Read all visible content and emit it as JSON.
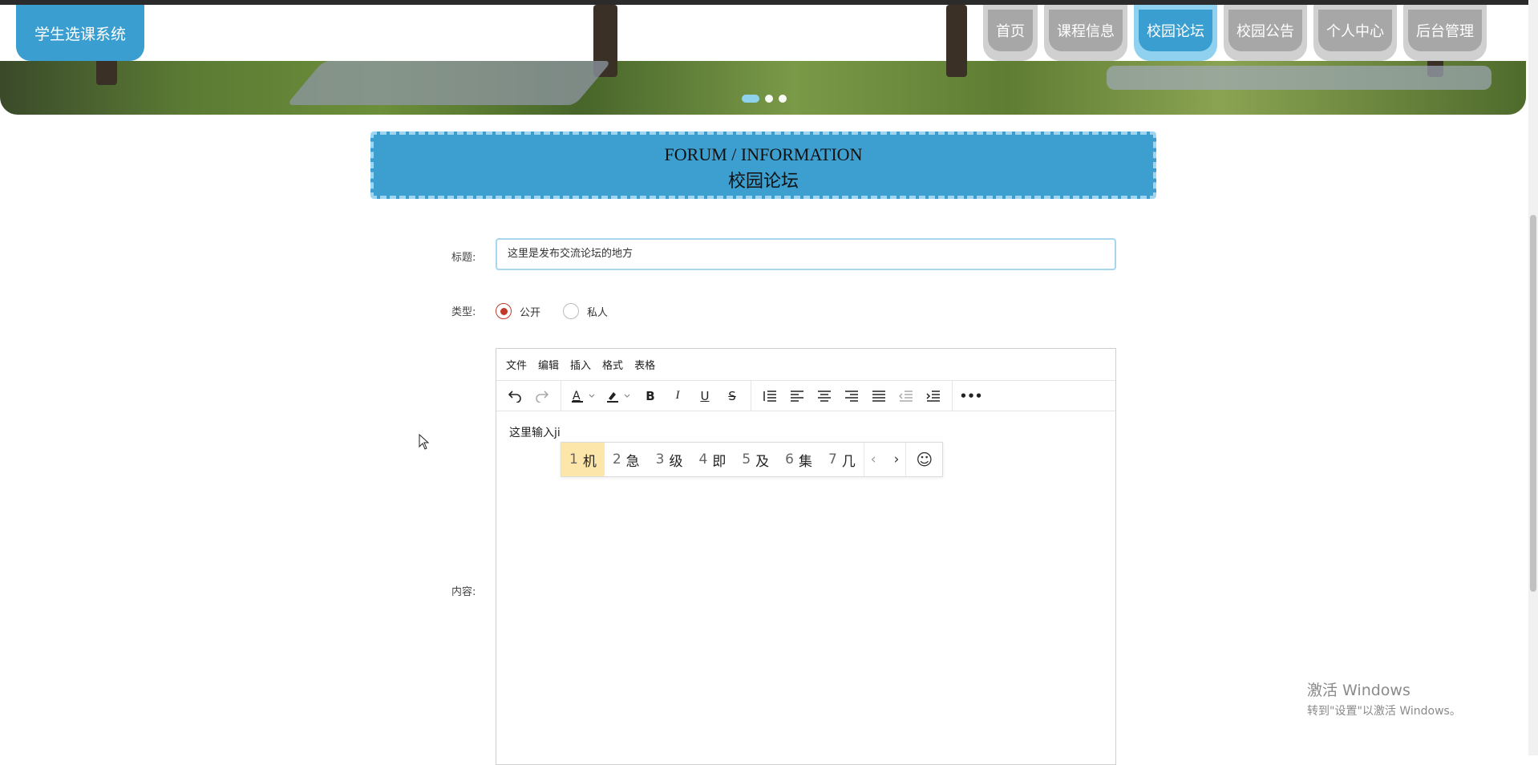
{
  "app": {
    "logo": "学生选课系统"
  },
  "nav": {
    "items": [
      {
        "label": "首页",
        "active": false
      },
      {
        "label": "课程信息",
        "active": false
      },
      {
        "label": "校园论坛",
        "active": true
      },
      {
        "label": "校园公告",
        "active": false
      },
      {
        "label": "个人中心",
        "active": false
      },
      {
        "label": "后台管理",
        "active": false
      }
    ]
  },
  "carousel": {
    "slides": 3,
    "active_index": 0
  },
  "section": {
    "title_en": "FORUM / INFORMATION",
    "title_zh": "校园论坛"
  },
  "form": {
    "title_label": "标题:",
    "title_value": "这里是发布交流论坛的地方",
    "type_label": "类型:",
    "type_options": [
      {
        "label": "公开",
        "checked": true
      },
      {
        "label": "私人",
        "checked": false
      }
    ],
    "content_label": "内容:"
  },
  "editor": {
    "menus": [
      "文件",
      "编辑",
      "插入",
      "格式",
      "表格"
    ],
    "content": "这里输入ji",
    "toolbar_icons": [
      "undo-icon",
      "redo-icon",
      "text-color-icon",
      "highlight-icon",
      "bold-icon",
      "italic-icon",
      "underline-icon",
      "strikethrough-icon",
      "line-height-icon",
      "align-left-icon",
      "align-center-icon",
      "align-right-icon",
      "align-justify-icon",
      "outdent-icon",
      "indent-icon",
      "more-icon"
    ]
  },
  "ime": {
    "candidates": [
      {
        "num": "1",
        "text": "机",
        "selected": true
      },
      {
        "num": "2",
        "text": "急",
        "selected": false
      },
      {
        "num": "3",
        "text": "级",
        "selected": false
      },
      {
        "num": "4",
        "text": "即",
        "selected": false
      },
      {
        "num": "5",
        "text": "及",
        "selected": false
      },
      {
        "num": "6",
        "text": "集",
        "selected": false
      },
      {
        "num": "7",
        "text": "几",
        "selected": false
      }
    ],
    "prev": "‹",
    "next": "›",
    "emoji": "☺"
  },
  "watermark": {
    "line1": "激活 Windows",
    "line2": "转到\"设置\"以激活 Windows。"
  },
  "colors": {
    "accent": "#3a9fd0",
    "nav_inactive": "#a7a7a7",
    "radio_checked": "#c0392b",
    "ime_selected": "#fde6a9"
  }
}
